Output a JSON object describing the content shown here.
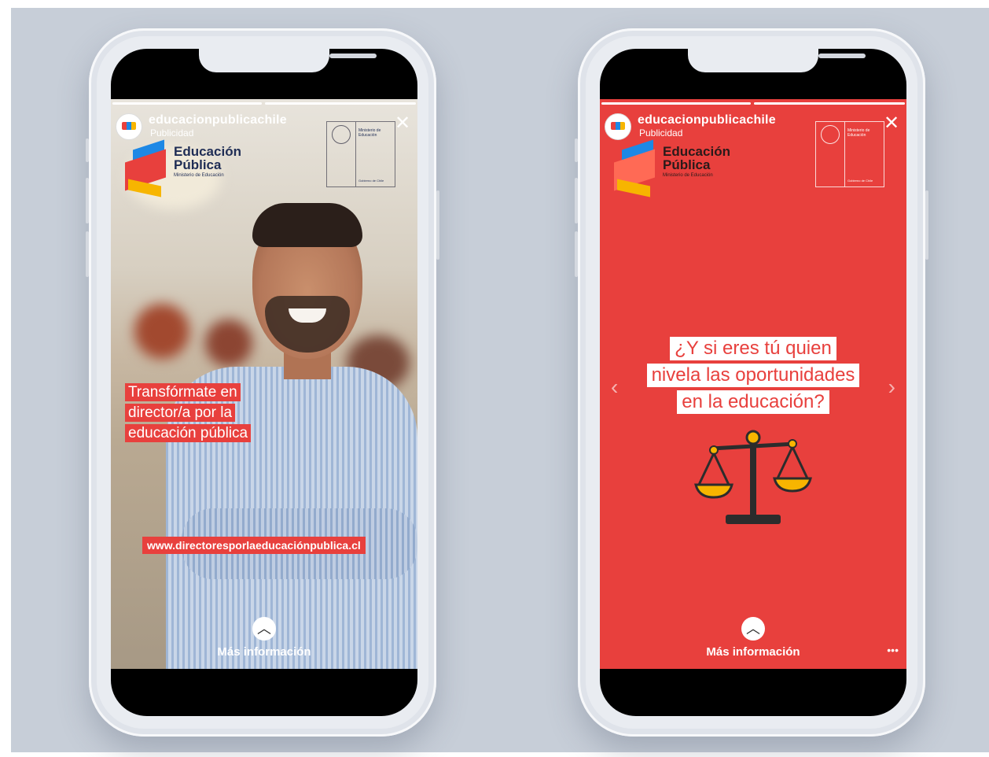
{
  "stories": [
    {
      "username": "educacionpublicachile",
      "sponsored_label": "Publicidad",
      "logo_title_line1": "Educación",
      "logo_title_line2": "Pública",
      "logo_subtitle": "Ministerio de Educación",
      "gov_ministry": "Ministerio de Educación",
      "gov_label": "Gobierno de Chile",
      "headline_lines": [
        "Transfórmate en",
        "director/a por la",
        "educación pública"
      ],
      "url": "www.directoresporlaeducaciónpublica.cl",
      "cta_label": "Más información",
      "close_icon": "✕",
      "chevron_icon": "︿"
    },
    {
      "username": "educacionpublicachile",
      "sponsored_label": "Publicidad",
      "logo_title_line1": "Educación",
      "logo_title_line2": "Pública",
      "logo_subtitle": "Ministerio de Educación",
      "gov_ministry": "Ministerio de Educación",
      "gov_label": "Gobierno de Chile",
      "question_lines": [
        "¿Y si eres tú quien",
        "nivela las oportunidades",
        "en la educación?"
      ],
      "cta_label": "Más información",
      "more_icon": "•••",
      "close_icon": "✕",
      "chevron_icon": "︿",
      "nav_left": "‹",
      "nav_right": "›"
    }
  ],
  "colors": {
    "brand_red": "#e8403d",
    "brand_blue": "#1e88e5",
    "brand_yellow": "#f7b500",
    "backdrop": "#c7ced8"
  }
}
